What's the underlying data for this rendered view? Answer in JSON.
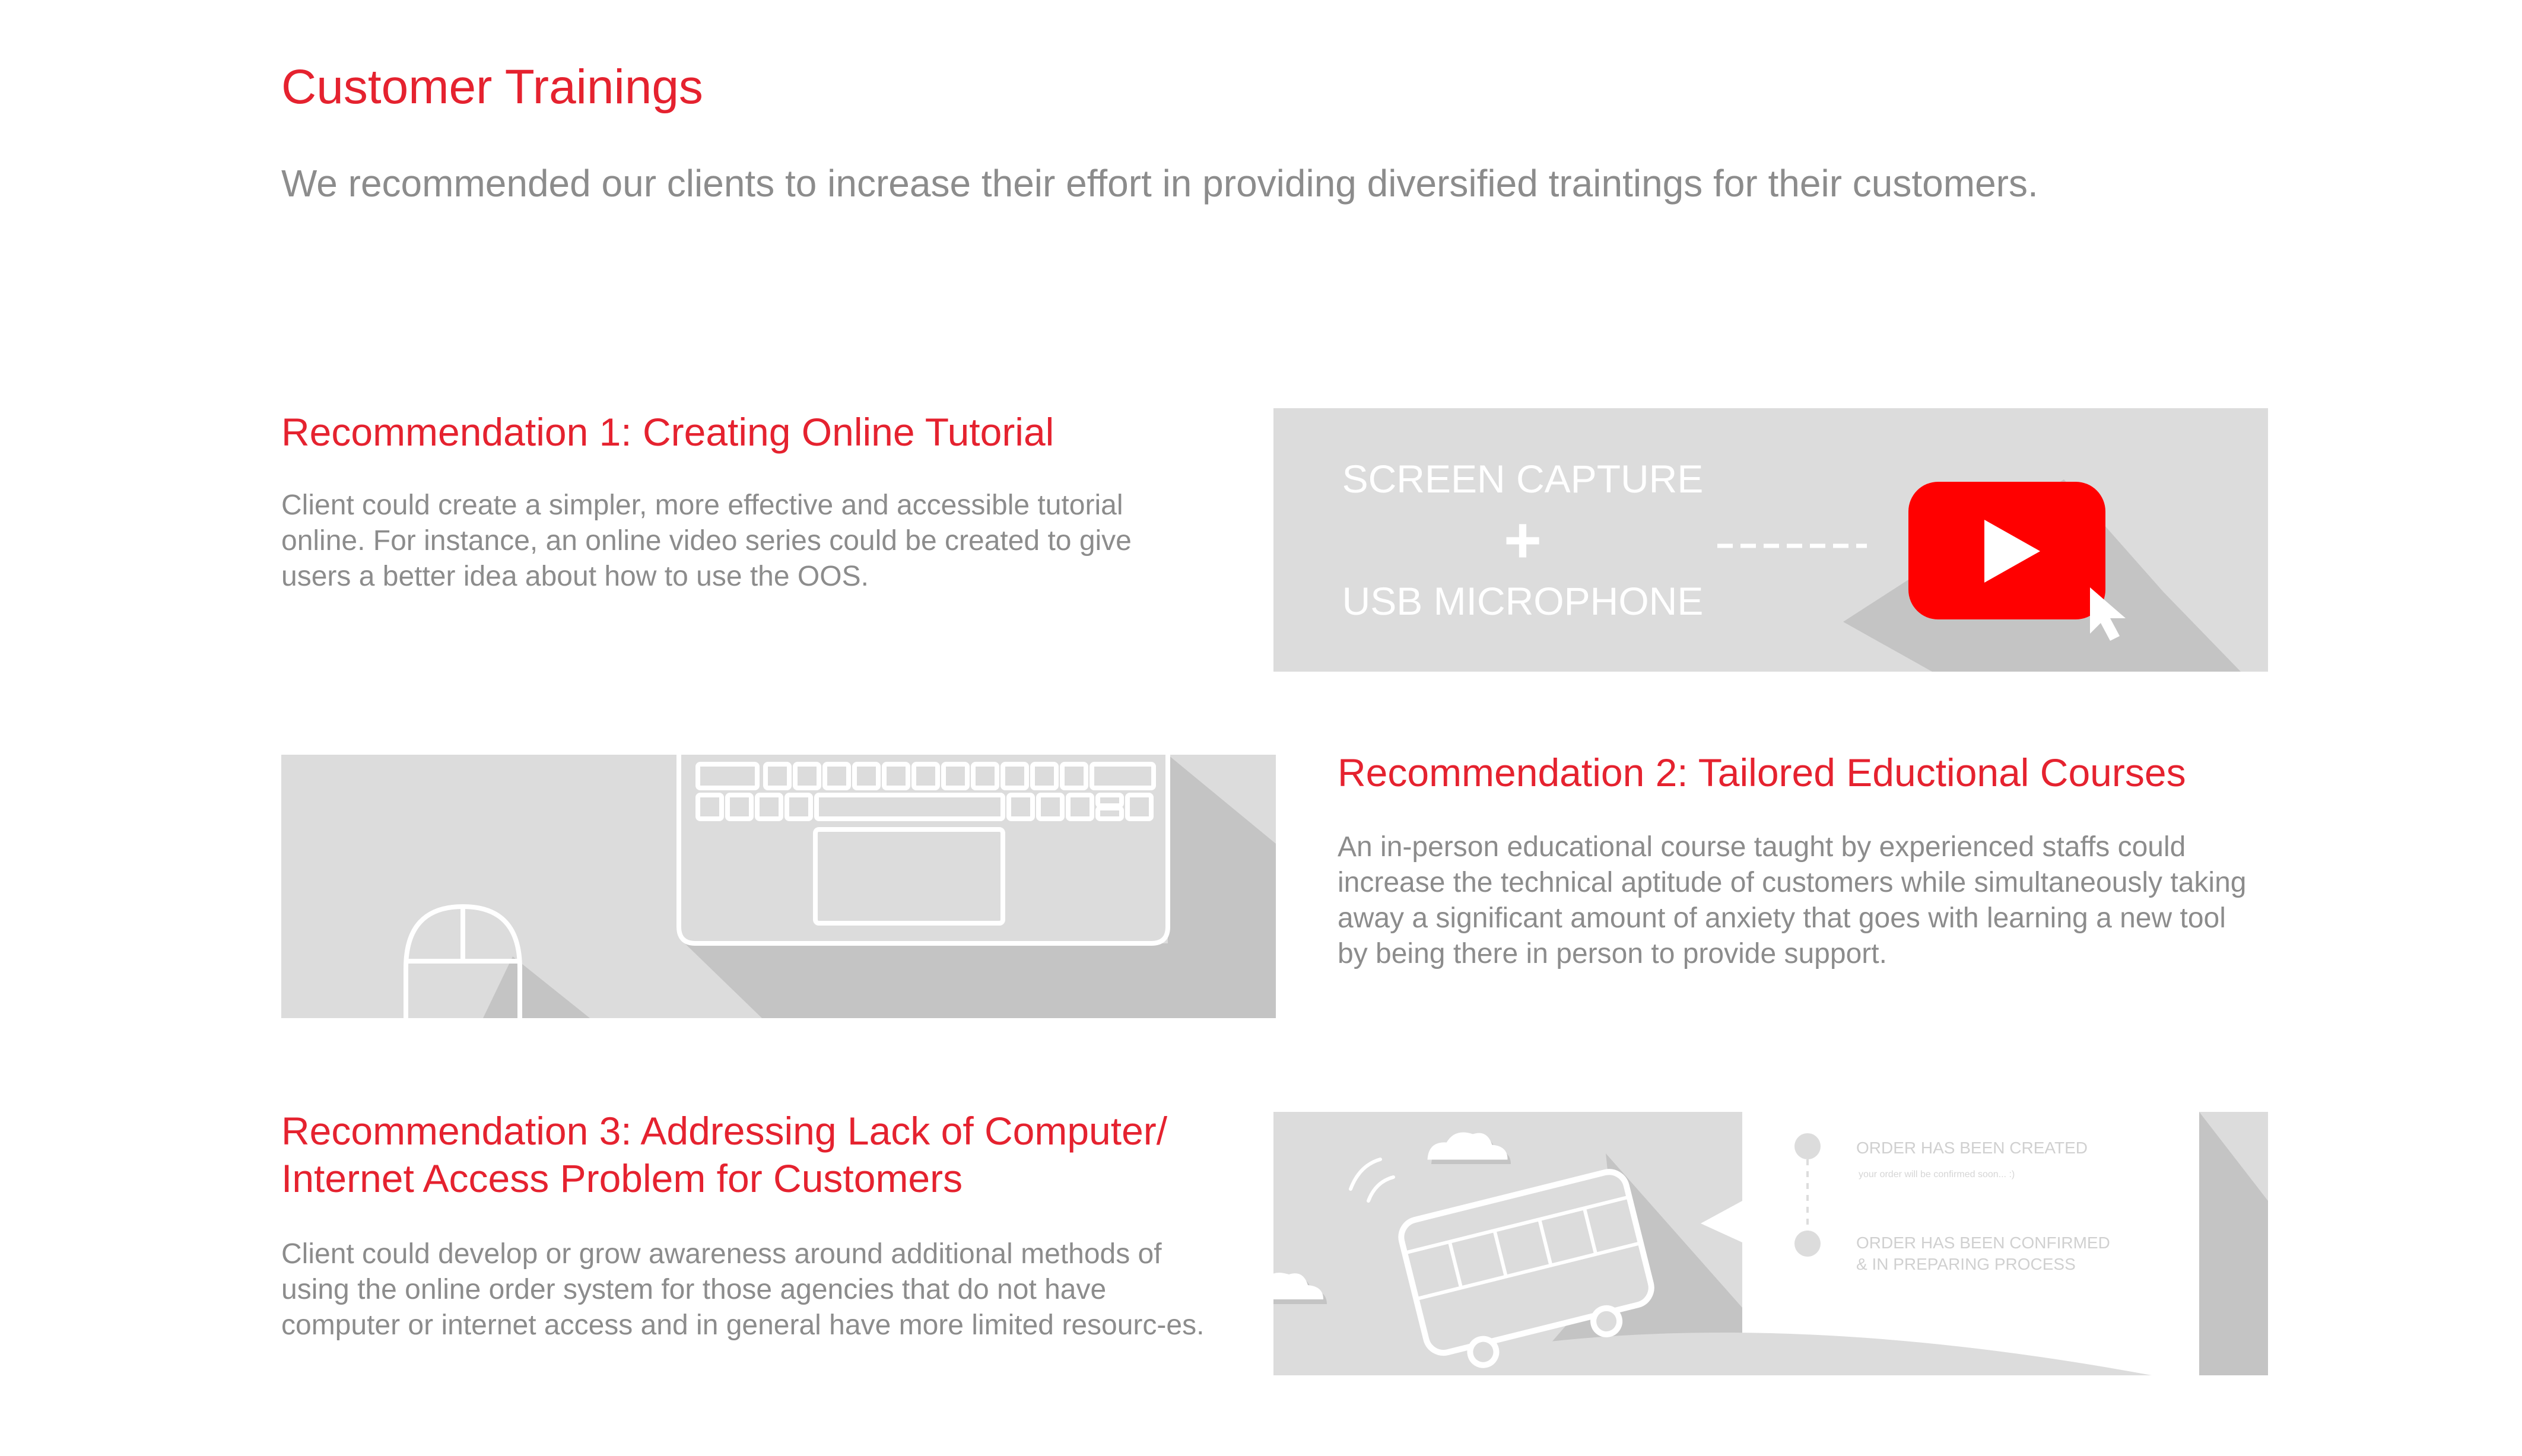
{
  "header": {
    "title": "Customer Trainings",
    "subtitle": "We recommended our clients to increase their effort in providing diversified traintings for their customers."
  },
  "recommendations": [
    {
      "heading": "Recommendation 1: Creating Online Tutorial",
      "body": "Client could create a simpler, more effective and accessible tutorial online. For instance, an online video series could be created to give users a better idea about how to use the OOS.",
      "illustration": {
        "line1": "SCREEN CAPTURE",
        "plus": "+",
        "line2": "USB MICROPHONE",
        "icons": [
          "play-button-icon",
          "cursor-arrow-icon"
        ]
      }
    },
    {
      "heading": "Recommendation 2: Tailored Eductional Courses",
      "body": "An in-person educational course taught by experienced staffs could increase the technical aptitude of customers while simultaneously taking away a significant amount of anxiety that goes with learning a new tool by being there in person to provide support.",
      "illustration": {
        "icons": [
          "laptop-keyboard-icon",
          "mouse-icon"
        ]
      }
    },
    {
      "heading_line1": "Recommendation 3: Addressing Lack of Computer/",
      "heading_line2": "Internet Access Problem for Customers",
      "body": "Client could develop or grow awareness around additional methods of using the online order system for those agencies that do not have computer or internet access and in general have more limited resourc-es.",
      "illustration": {
        "status1": "ORDER HAS BEEN CREATED",
        "status1_sub": "your order will be confirmed soon... :)",
        "status2_line1": "ORDER HAS BEEN CONFIRMED",
        "status2_line2": "& IN PREPARING PROCESS",
        "icons": [
          "bus-icon",
          "cloud-icon",
          "timeline-dot-icon"
        ]
      }
    }
  ],
  "colors": {
    "accent": "#e5222f",
    "text_gray": "#8c8c8c",
    "panel_bg": "#dcdcdc",
    "shadow": "#c4c4c4",
    "youtube_red": "#ff0000"
  }
}
